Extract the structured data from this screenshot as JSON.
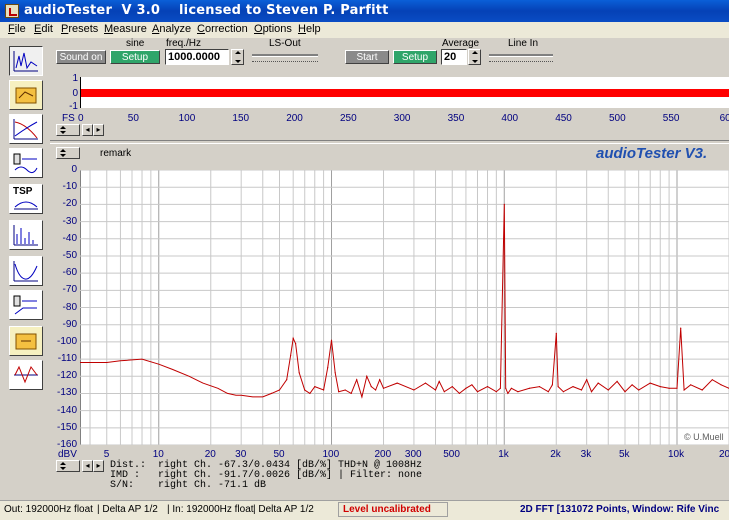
{
  "window": {
    "title": "audioTester  V 3.0    licensed to Steven P. Parfitt"
  },
  "menu": [
    {
      "label": "File",
      "u": "F"
    },
    {
      "label": "Edit",
      "u": "E"
    },
    {
      "label": "Presets",
      "u": "P"
    },
    {
      "label": "Measure",
      "u": "M"
    },
    {
      "label": "Analyze",
      "u": "A"
    },
    {
      "label": "Correction",
      "u": "C"
    },
    {
      "label": "Options",
      "u": "O"
    },
    {
      "label": "Help",
      "u": "H"
    }
  ],
  "toolbar": {
    "sine_label": "sine",
    "freq_label": "freq./Hz",
    "ls_out_label": "LS-Out",
    "average_label": "Average",
    "line_in_label": "Line In",
    "sound_on": "Sound on",
    "setup1": "Setup",
    "freq_value": "1000.0000",
    "start": "Start",
    "setup2": "Setup",
    "average_value": "20"
  },
  "top_strip": {
    "y_ticks": [
      "1",
      "0",
      "-1"
    ],
    "fs_label": "FS",
    "x_ticks": [
      "0",
      "50",
      "100",
      "150",
      "200",
      "250",
      "300",
      "350",
      "400",
      "450",
      "500",
      "550",
      "60"
    ]
  },
  "remark_label": "remark",
  "watermark": "audioTester V3.",
  "copyright": "© U.Muell",
  "plot": {
    "unit_label": "dBV",
    "y_ticks": [
      "0",
      "-10",
      "-20",
      "-30",
      "-40",
      "-50",
      "-60",
      "-70",
      "-80",
      "-90",
      "-100",
      "-110",
      "-120",
      "-130",
      "-140",
      "-150",
      "-160"
    ],
    "x_ticks": [
      "5",
      "10",
      "20",
      "30",
      "50",
      "100",
      "200",
      "300",
      "500",
      "1k",
      "2k",
      "3k",
      "5k",
      "10k",
      "20"
    ],
    "trace_color": "#c00000"
  },
  "chart_data": {
    "type": "line",
    "xscale": "log",
    "xlabel": "",
    "ylabel": "dBV",
    "xlim": [
      3.5,
      20000
    ],
    "ylim": [
      -160,
      0
    ],
    "series": [
      {
        "x": [
          3.5,
          5,
          6,
          8,
          10,
          12,
          15,
          18,
          22,
          25,
          28,
          30,
          35,
          40,
          45,
          50,
          55,
          58,
          60,
          62,
          65,
          70,
          75,
          80,
          90,
          95,
          100,
          105,
          110,
          120,
          130,
          140,
          150,
          160,
          170,
          180,
          190,
          200,
          240,
          300,
          350,
          400,
          420,
          450,
          500,
          550,
          600,
          650,
          700,
          800,
          900,
          950,
          1000,
          1020,
          1050,
          1100,
          1200,
          1400,
          1600,
          1800,
          1900,
          2000,
          2050,
          2200,
          2500,
          2800,
          3000,
          3200,
          3500,
          4000,
          4500,
          5000,
          5500,
          6000,
          7000,
          8000,
          9000,
          10000,
          10500,
          11000,
          12000,
          14000,
          16000,
          18000,
          20000
        ],
        "values": [
          -112,
          -112,
          -111,
          -110,
          -113,
          -116,
          -120,
          -124,
          -127,
          -130,
          -131,
          -131,
          -132,
          -132,
          -130,
          -128,
          -122,
          -108,
          -98,
          -101,
          -118,
          -128,
          -130,
          -126,
          -128,
          -115,
          -99,
          -118,
          -129,
          -128,
          -130,
          -122,
          -132,
          -120,
          -126,
          -128,
          -122,
          -127,
          -124,
          -128,
          -124,
          -128,
          -123,
          -129,
          -126,
          -130,
          -127,
          -125,
          -129,
          -126,
          -129,
          -127,
          -20,
          -127,
          -130,
          -127,
          -129,
          -127,
          -126,
          -129,
          -125,
          -95,
          -126,
          -129,
          -126,
          -128,
          -122,
          -129,
          -124,
          -128,
          -123,
          -129,
          -125,
          -128,
          -124,
          -126,
          -127,
          -127,
          -92,
          -128,
          -125,
          -128,
          -122,
          -125,
          -127
        ]
      }
    ]
  },
  "measurements": {
    "dist_label": "Dist.:",
    "dist_value": "right Ch. -67.3/0.0434 [dB/%] THD+N @ 1008Hz",
    "imd_label": "IMD :",
    "imd_value": "right Ch. -91.7/0.0026 [dB/%]  |   Filter: none",
    "sn_label": "S/N:",
    "sn_value": "right Ch. -71.1 dB"
  },
  "status": {
    "out": "Out: 192000Hz float",
    "delta1": "| Delta AP 1/2",
    "in": "| In: 192000Hz float",
    "delta2": "| Delta AP 1/2",
    "level": "Level uncalibrated",
    "fft": "2D FFT [131072 Points, Window: Rife Vinc"
  }
}
